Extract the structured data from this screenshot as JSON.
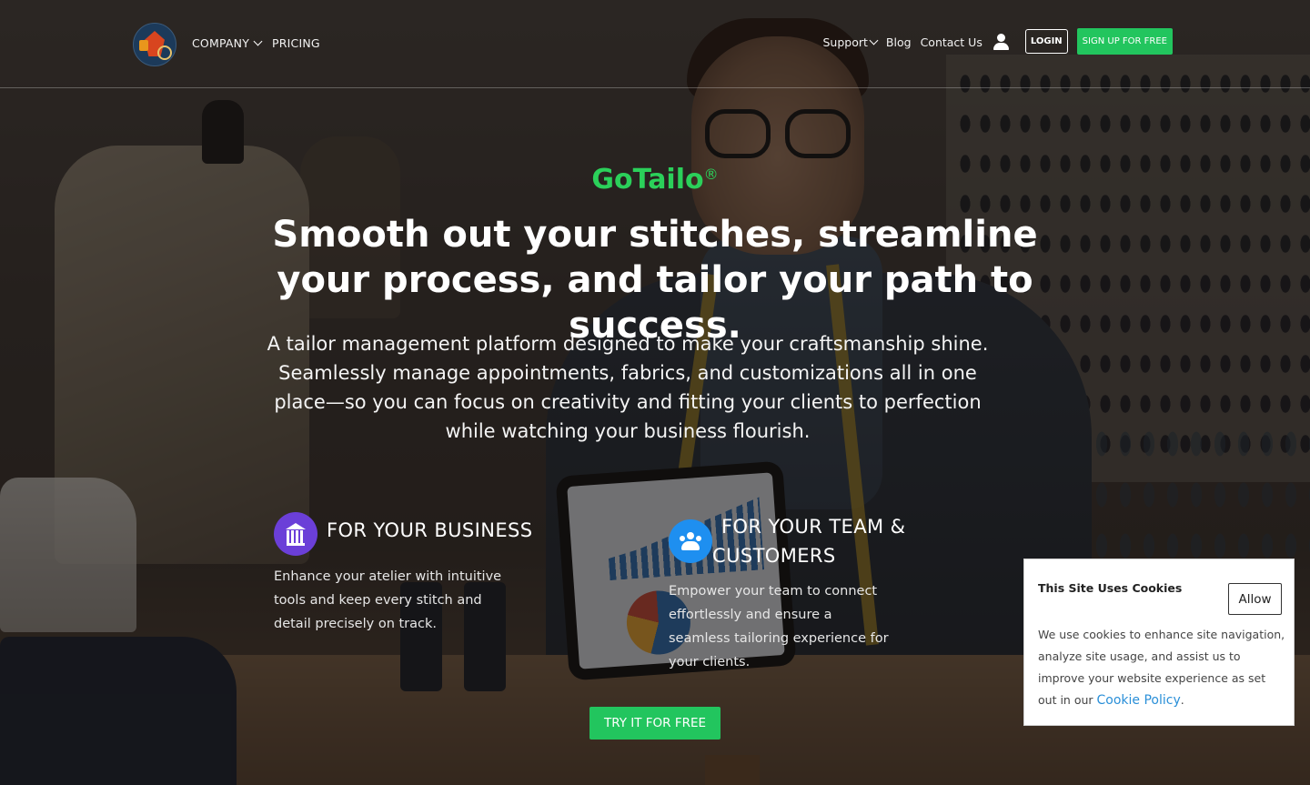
{
  "header": {
    "logo_icon": "tailor-logo-icon",
    "nav_left": [
      {
        "label": "COMPANY",
        "has_dropdown": true
      },
      {
        "label": "PRICING",
        "has_dropdown": false
      }
    ],
    "nav_right": [
      {
        "label": "Support",
        "has_dropdown": true
      },
      {
        "label": "Blog",
        "has_dropdown": false
      },
      {
        "label": "Contact Us",
        "has_dropdown": false
      }
    ],
    "user_icon": "user-icon",
    "login_label": "LOGIN",
    "signup_label": "SIGN UP FOR FREE"
  },
  "hero": {
    "brand": "GoTailo",
    "brand_mark": "®",
    "headline": "Smooth out your stitches, streamline your process, and tailor your path to success.",
    "lead": "A tailor management platform designed to make your craftsmanship shine. Seamlessly manage appointments, fabrics, and customizations all in one place—so you can focus on creativity and fitting your clients to perfection while watching your business flourish."
  },
  "features": [
    {
      "icon": "bank-icon",
      "title": "FOR YOUR BUSINESS",
      "text": "Enhance your atelier with intuitive tools and keep every stitch and detail precisely on track."
    },
    {
      "icon": "team-icon",
      "title": "FOR YOUR TEAM & CUSTOMERS",
      "text": "Empower your team to connect effortlessly and ensure a seamless tailoring experience for your clients."
    }
  ],
  "cta_label": "TRY IT FOR FREE",
  "cookie": {
    "title": "This Site Uses Cookies",
    "allow_label": "Allow",
    "text": "We use cookies to enhance site navigation, analyze site usage, and assist us to improve your website experience as set out in our",
    "link_label": "Cookie Policy",
    "link_suffix": "."
  },
  "colors": {
    "accent_green": "#22c55e",
    "brand_green": "#2bd05a",
    "business_icon_bg": "#6b3fd8",
    "team_icon_bg": "#1e8ff0",
    "link_blue": "#2a8fd8"
  }
}
